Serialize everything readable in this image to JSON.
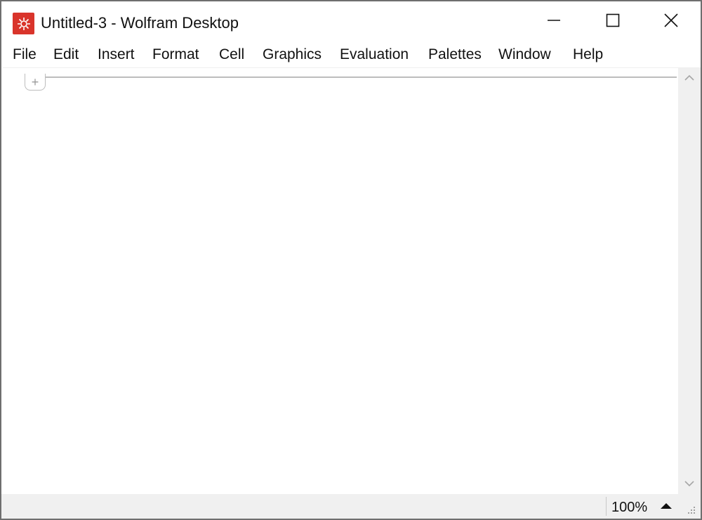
{
  "window": {
    "title": "Untitled-3 - Wolfram Desktop",
    "app_icon": "wolfram-spikey-icon",
    "controls": {
      "minimize": "minimize-icon",
      "maximize": "maximize-icon",
      "close": "close-icon"
    }
  },
  "menubar": {
    "items": [
      "File",
      "Edit",
      "Insert",
      "Format",
      "Cell",
      "Graphics",
      "Evaluation",
      "Palettes",
      "Window",
      "Help"
    ]
  },
  "notebook": {
    "cell_insert_symbol": "+"
  },
  "statusbar": {
    "zoom": "100%"
  },
  "colors": {
    "brand": "#d9342b",
    "chrome": "#f0f0f0",
    "cell_bracket": "#bdbdbd"
  }
}
